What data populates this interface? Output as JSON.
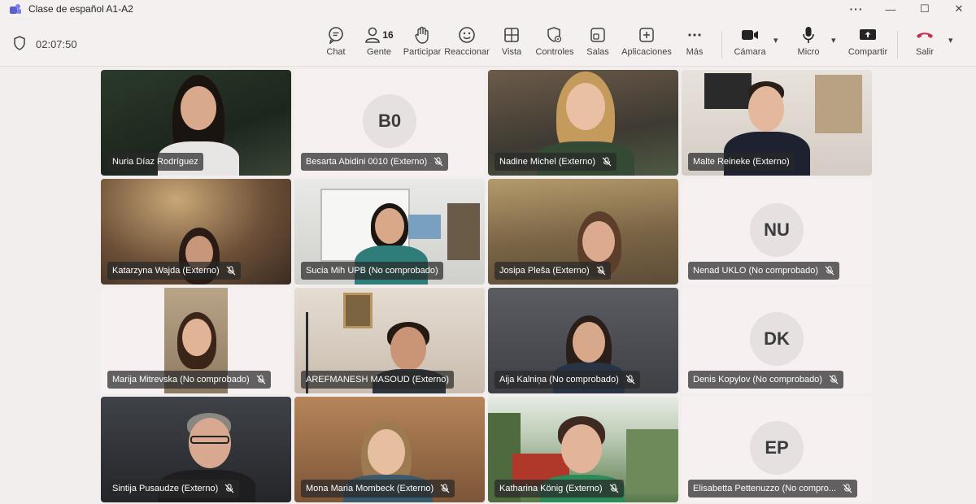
{
  "window": {
    "title": "Clase de español A1-A2",
    "controls": [
      "···",
      "—",
      "☐",
      "✕"
    ]
  },
  "meeting": {
    "timer": "02:07:50",
    "people_count": "16",
    "buttons": {
      "chat": "Chat",
      "people": "Gente",
      "raise": "Participar",
      "react": "Reaccionar",
      "view": "Vista",
      "controls": "Controles",
      "rooms": "Salas",
      "apps": "Aplicaciones",
      "more": "Más",
      "camera": "Cámara",
      "mic": "Micro",
      "share": "Compartir",
      "leave": "Salir"
    }
  },
  "participants": [
    {
      "name": "Nuria Díaz Rodríguez",
      "video": true,
      "muted": false
    },
    {
      "name": "Besarta Abidini 0010 (Externo)",
      "initials": "B0",
      "video": false,
      "muted": true
    },
    {
      "name": "Nadine Michel (Externo)",
      "video": true,
      "muted": true
    },
    {
      "name": "Malte Reineke (Externo)",
      "video": true,
      "muted": false
    },
    {
      "name": "Katarzyna Wajda (Externo)",
      "video": true,
      "muted": true
    },
    {
      "name": "Sucia Mih UPB (No comprobado)",
      "video": true,
      "muted": false
    },
    {
      "name": "Josipa Pleša (Externo)",
      "video": true,
      "muted": true
    },
    {
      "name": "Nenad UKLO (No comprobado)",
      "initials": "NU",
      "video": false,
      "muted": true
    },
    {
      "name": "Marija Mitrevska (No comprobado)",
      "video": true,
      "muted": true
    },
    {
      "name": "AREFMANESH MASOUD (Externo)",
      "video": true,
      "muted": false
    },
    {
      "name": "Aija Kalniņa (No comprobado)",
      "video": true,
      "muted": true
    },
    {
      "name": "Denis Kopylov (No comprobado)",
      "initials": "DK",
      "video": false,
      "muted": true
    },
    {
      "name": "Sintija Pusaudze (Externo)",
      "video": true,
      "muted": true
    },
    {
      "name": "Mona Maria Mombeck (Externo)",
      "video": true,
      "muted": true
    },
    {
      "name": "Katharina König (Externo)",
      "video": true,
      "muted": true
    },
    {
      "name": "Elisabetta Pettenuzzo (No compro...",
      "initials": "EP",
      "video": false,
      "muted": true
    }
  ],
  "colors": {
    "leave_red": "#c4314b",
    "tile_bg": "#f6f0f0",
    "toolbar_bg": "#f5f0f0"
  }
}
